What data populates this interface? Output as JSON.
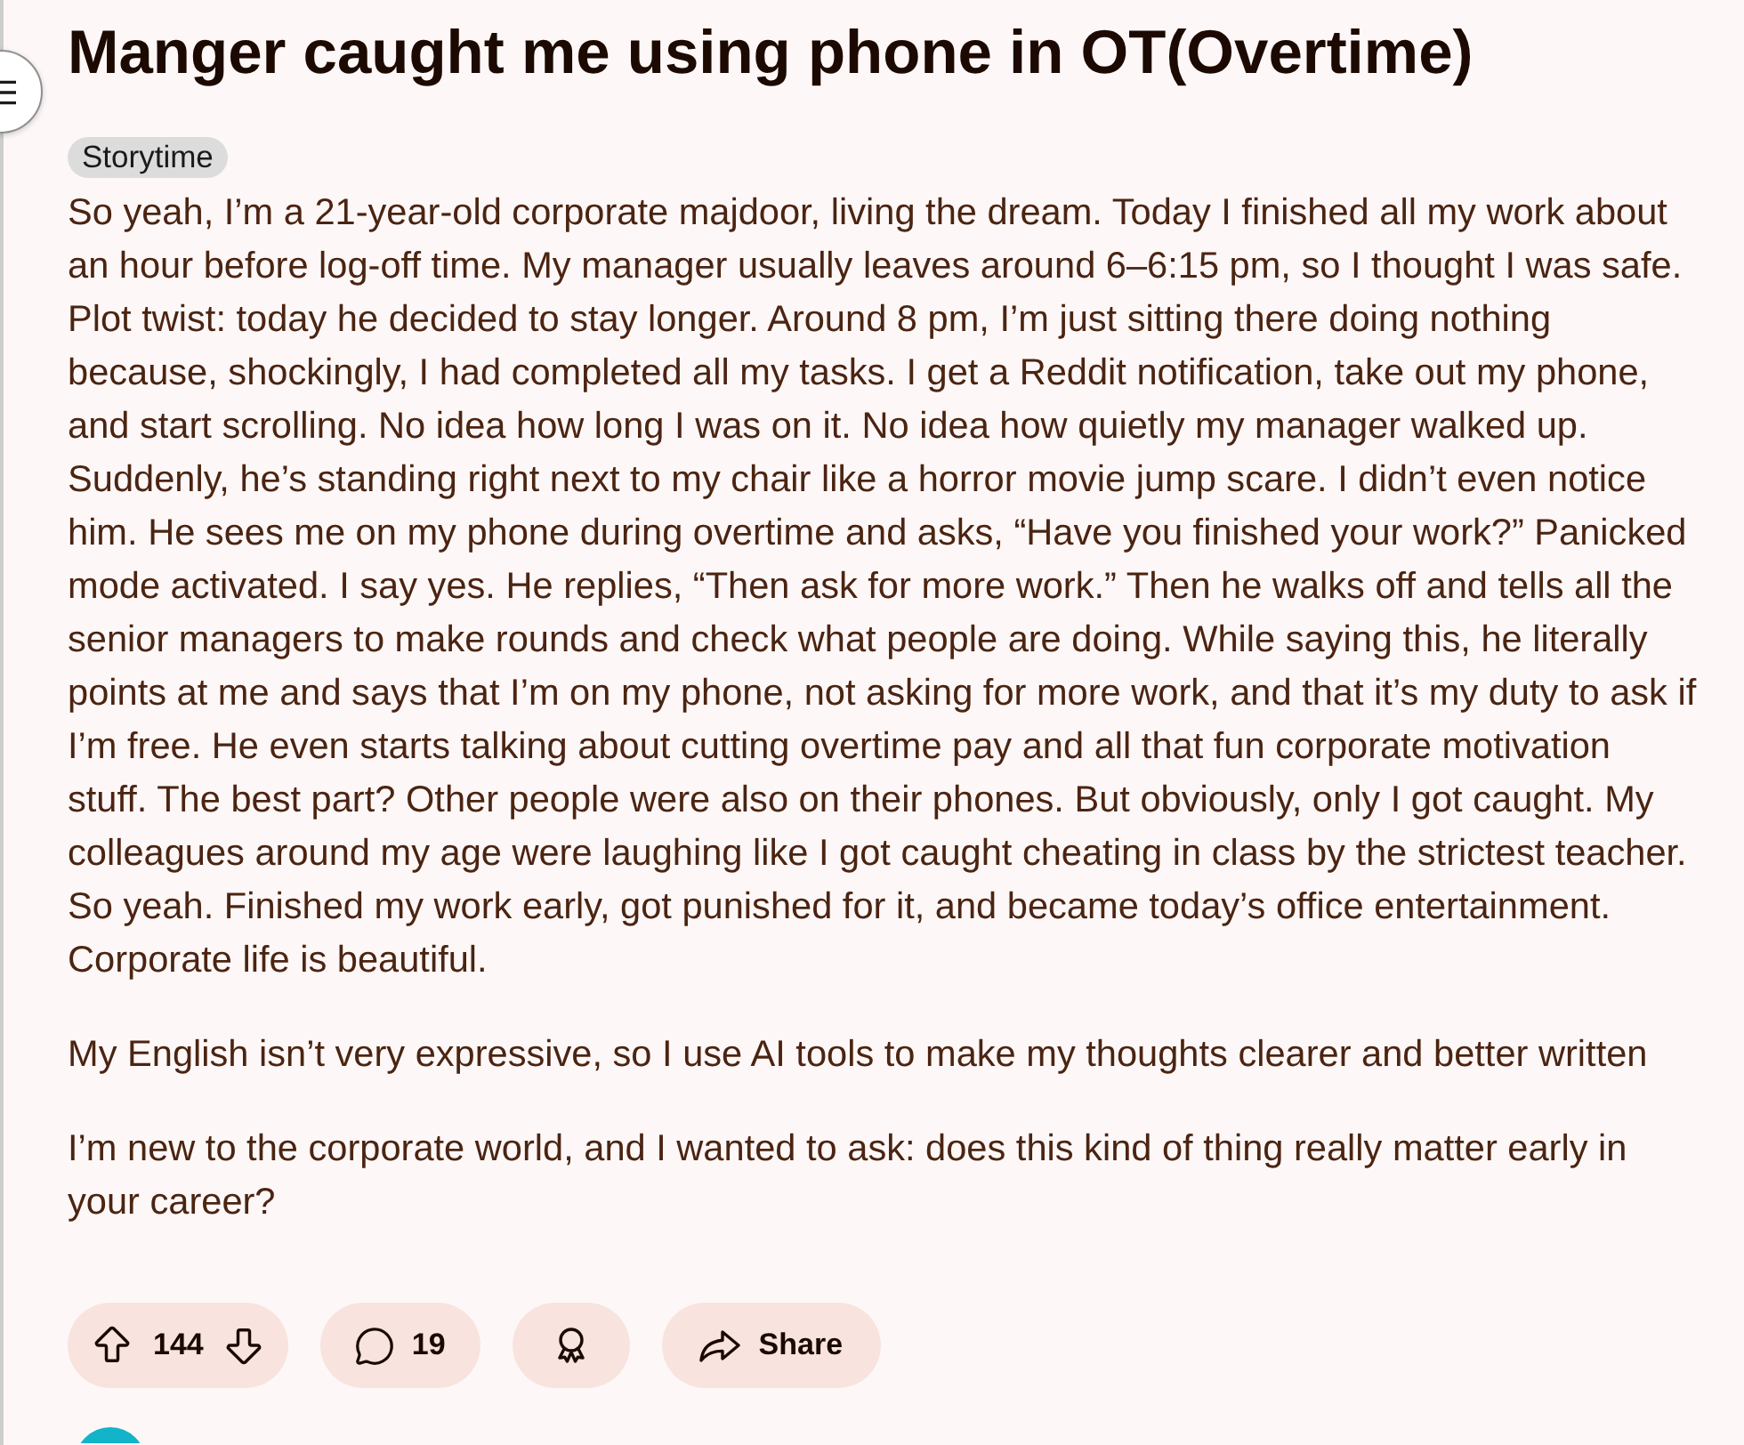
{
  "post": {
    "title": "Manger caught me using phone in OT(Overtime)",
    "flair": "Storytime",
    "body": [
      "So yeah, I’m a 21-year-old corporate majdoor, living the dream. Today I finished all my work about an hour before log-off time. My manager usually leaves around 6–6:15 pm, so I thought I was safe. Plot twist: today he decided to stay longer. Around 8 pm, I’m just sitting there doing nothing because, shockingly, I had completed all my tasks. I get a Reddit notification, take out my phone, and start scrolling. No idea how long I was on it. No idea how quietly my manager walked up. Suddenly, he’s standing right next to my chair like a horror movie jump scare. I didn’t even notice him. He sees me on my phone during overtime and asks, “Have you finished your work?” Panicked mode activated. I say yes. He replies, “Then ask for more work.” Then he walks off and tells all the senior managers to make rounds and check what people are doing. While saying this, he literally points at me and says that I’m on my phone, not asking for more work, and that it’s my duty to ask if I’m free. He even starts talking about cutting overtime pay and all that fun corporate motivation stuff. The best part? Other people were also on their phones. But obviously, only I got caught. My colleagues around my age were laughing like I got caught cheating in class by the strictest teacher. So yeah. Finished my work early, got punished for it, and became today’s office entertainment. Corporate life is beautiful.",
      "My English isn’t very expressive, so I use AI tools to make my thoughts clearer and better written",
      "I’m new to the corporate world, and I wanted to ask: does this kind of thing really matter early in your career?"
    ]
  },
  "actions": {
    "score": "144",
    "comments": "19",
    "share": "Share"
  }
}
